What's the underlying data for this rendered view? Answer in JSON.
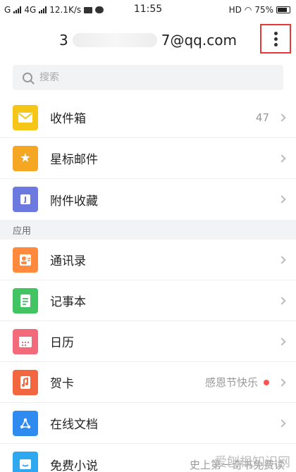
{
  "status": {
    "carrier": "G",
    "network": "4G",
    "speed": "12.1K/s",
    "time": "11:55",
    "hd": "HD",
    "battery": "75%"
  },
  "header": {
    "email_prefix": "3",
    "email_suffix": "7@qq.com"
  },
  "search": {
    "placeholder": "搜索"
  },
  "mail_items": [
    {
      "label": "收件箱",
      "count": "47",
      "icon": "inbox-icon",
      "color": "#f5c518"
    },
    {
      "label": "星标邮件",
      "icon": "star-icon",
      "color": "#f5a623"
    },
    {
      "label": "附件收藏",
      "icon": "attachment-icon",
      "color": "#6c7ae0"
    }
  ],
  "section_label": "应用",
  "app_items": [
    {
      "label": "通讯录",
      "icon": "contacts-icon",
      "color": "#ff8a3d"
    },
    {
      "label": "记事本",
      "icon": "notebook-icon",
      "color": "#43c463"
    },
    {
      "label": "日历",
      "icon": "calendar-icon",
      "color": "#f36b7a"
    },
    {
      "label": "贺卡",
      "extra": "感恩节快乐",
      "icon": "card-icon",
      "color": "#f2673f"
    },
    {
      "label": "在线文档",
      "icon": "document-icon",
      "color": "#2f8bf0"
    },
    {
      "label": "免费小说",
      "extra": "史上第一奇书免费读",
      "icon": "novel-icon",
      "color": "#2fa8f0"
    }
  ],
  "watermark": "爱刨根知识网"
}
